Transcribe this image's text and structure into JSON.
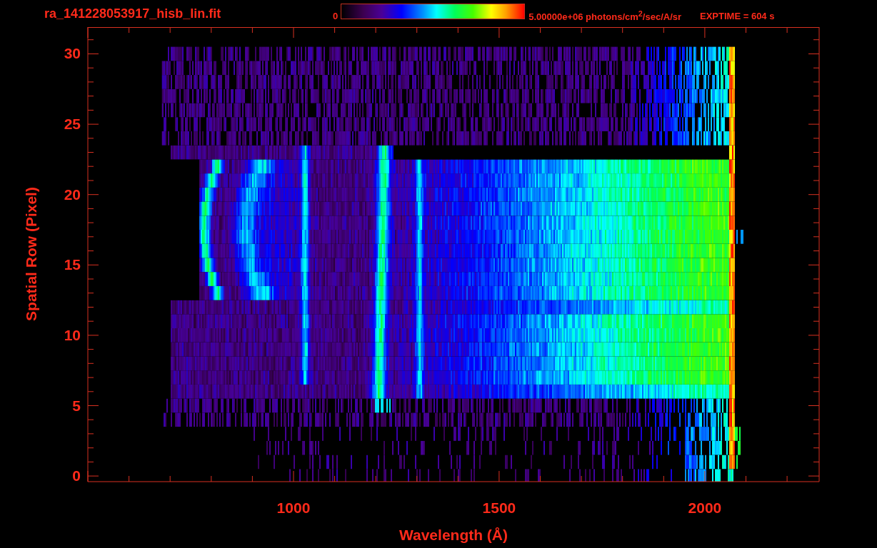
{
  "title": "ra_141228053917_hisb_lin.fit",
  "colorbar": {
    "min_label": "0",
    "max_label": "5.00000e+06 photons/cm$^{2}$/sec/A/sr"
  },
  "exposure": "EXPTIME = 604 s",
  "plot": {
    "xlabel": "Wavelength (Å)",
    "ylabel": "Spatial Row (Pixel)",
    "xtick_labels": [
      "1000",
      "1500",
      "2000"
    ],
    "ytick_labels": [
      "30",
      "25",
      "20",
      "15",
      "10",
      "5",
      "0"
    ]
  }
}
